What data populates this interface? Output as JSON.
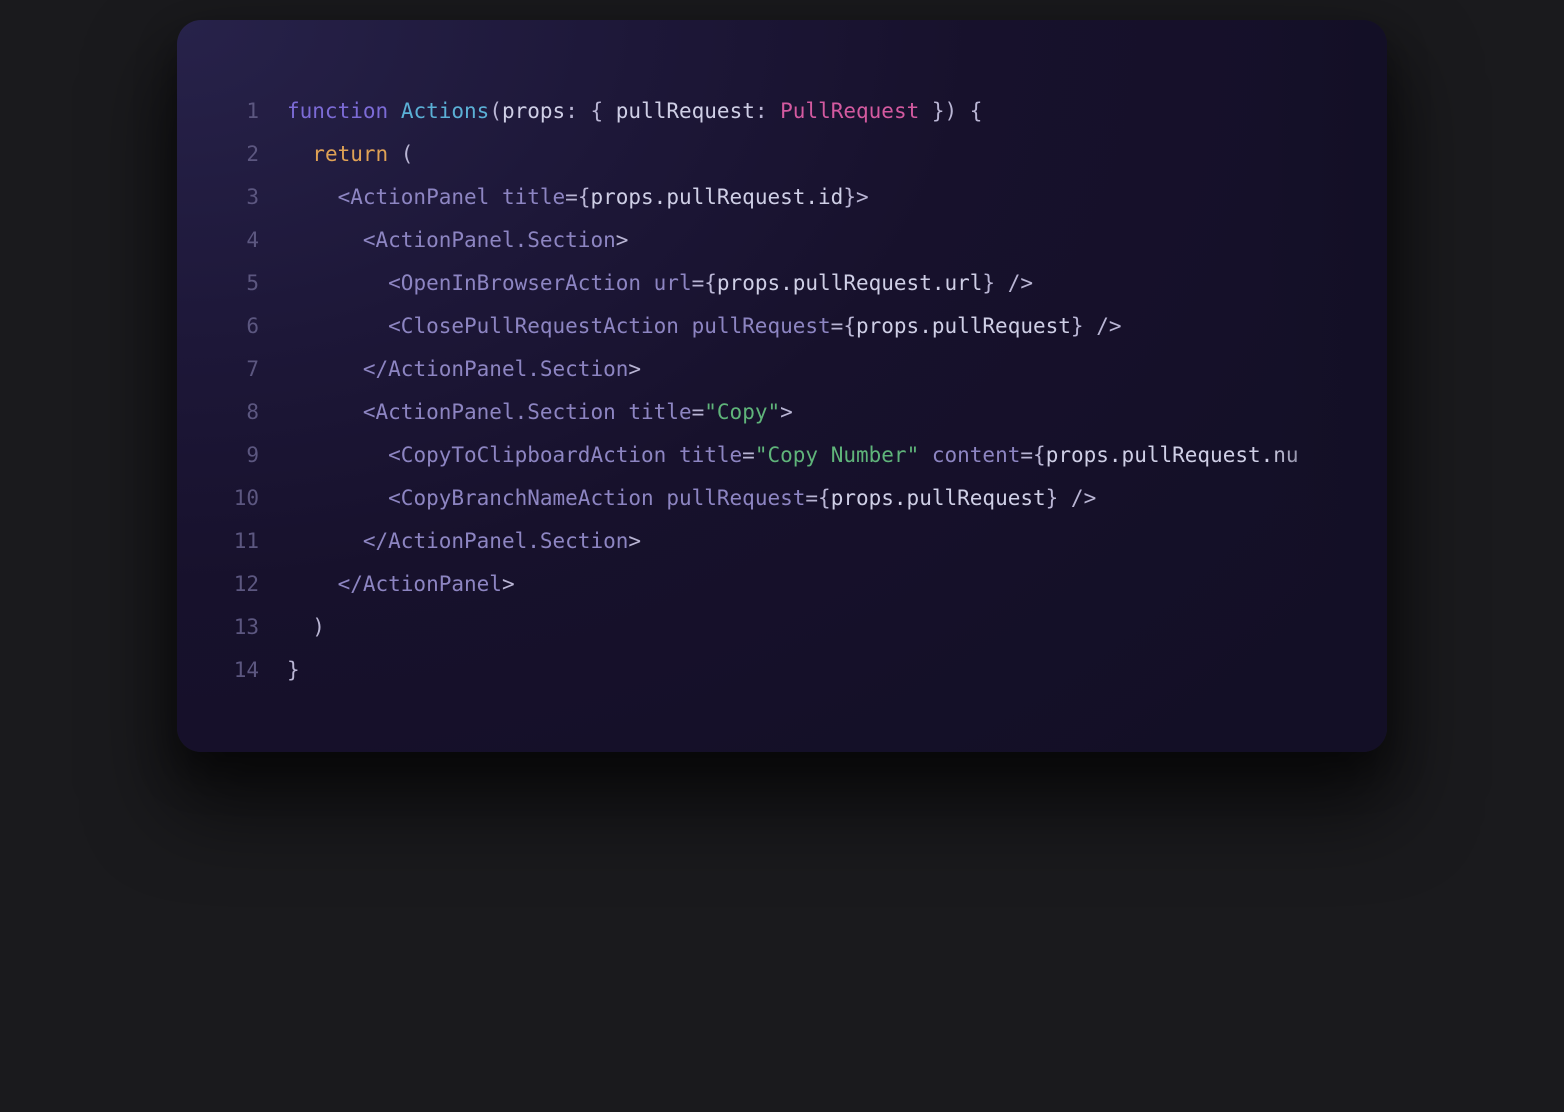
{
  "colors": {
    "keyword_purple": "#7c6bd6",
    "tag_purple": "#8d85c2",
    "function_cyan": "#5bb0d6",
    "return_orange": "#e0a255",
    "type_pink": "#d45aa0",
    "string_green": "#5fb47a",
    "default_white": "#cfcfe6",
    "punct_grey": "#b9b5d4",
    "line_number": "#5c5780"
  },
  "line_numbers": [
    "1",
    "2",
    "3",
    "4",
    "5",
    "6",
    "7",
    "8",
    "9",
    "10",
    "11",
    "12",
    "13",
    "14"
  ],
  "code_lines": [
    [
      {
        "t": "function",
        "c": "keyword_purple"
      },
      {
        "t": " ",
        "c": "default_white"
      },
      {
        "t": "Actions",
        "c": "function_cyan"
      },
      {
        "t": "(",
        "c": "punct_grey"
      },
      {
        "t": "props",
        "c": "default_white"
      },
      {
        "t": ": { ",
        "c": "punct_grey"
      },
      {
        "t": "pullRequest",
        "c": "default_white"
      },
      {
        "t": ": ",
        "c": "punct_grey"
      },
      {
        "t": "PullRequest",
        "c": "type_pink"
      },
      {
        "t": " }) {",
        "c": "punct_grey"
      }
    ],
    [
      {
        "t": "  ",
        "c": "default_white"
      },
      {
        "t": "return",
        "c": "return_orange"
      },
      {
        "t": " (",
        "c": "punct_grey"
      }
    ],
    [
      {
        "t": "    <",
        "c": "tag_purple"
      },
      {
        "t": "ActionPanel",
        "c": "tag_purple"
      },
      {
        "t": " title",
        "c": "tag_purple"
      },
      {
        "t": "=",
        "c": "punct_grey"
      },
      {
        "t": "{",
        "c": "punct_grey"
      },
      {
        "t": "props.pullRequest.id",
        "c": "default_white"
      },
      {
        "t": "}>",
        "c": "punct_grey"
      }
    ],
    [
      {
        "t": "      <",
        "c": "tag_purple"
      },
      {
        "t": "ActionPanel.Section",
        "c": "tag_purple"
      },
      {
        "t": ">",
        "c": "punct_grey"
      }
    ],
    [
      {
        "t": "        <",
        "c": "tag_purple"
      },
      {
        "t": "OpenInBrowserAction",
        "c": "tag_purple"
      },
      {
        "t": " url",
        "c": "tag_purple"
      },
      {
        "t": "=",
        "c": "punct_grey"
      },
      {
        "t": "{",
        "c": "punct_grey"
      },
      {
        "t": "props.pullRequest.url",
        "c": "default_white"
      },
      {
        "t": "} />",
        "c": "punct_grey"
      }
    ],
    [
      {
        "t": "        <",
        "c": "tag_purple"
      },
      {
        "t": "ClosePullRequestAction",
        "c": "tag_purple"
      },
      {
        "t": " pullRequest",
        "c": "tag_purple"
      },
      {
        "t": "=",
        "c": "punct_grey"
      },
      {
        "t": "{",
        "c": "punct_grey"
      },
      {
        "t": "props.pullRequest",
        "c": "default_white"
      },
      {
        "t": "} />",
        "c": "punct_grey"
      }
    ],
    [
      {
        "t": "      </",
        "c": "tag_purple"
      },
      {
        "t": "ActionPanel.Section",
        "c": "tag_purple"
      },
      {
        "t": ">",
        "c": "punct_grey"
      }
    ],
    [
      {
        "t": "      <",
        "c": "tag_purple"
      },
      {
        "t": "ActionPanel.Section",
        "c": "tag_purple"
      },
      {
        "t": " title",
        "c": "tag_purple"
      },
      {
        "t": "=",
        "c": "punct_grey"
      },
      {
        "t": "\"",
        "c": "string_green"
      },
      {
        "t": "Copy",
        "c": "string_green"
      },
      {
        "t": "\"",
        "c": "string_green"
      },
      {
        "t": ">",
        "c": "punct_grey"
      }
    ],
    [
      {
        "t": "        <",
        "c": "tag_purple"
      },
      {
        "t": "CopyToClipboardAction",
        "c": "tag_purple"
      },
      {
        "t": " title",
        "c": "tag_purple"
      },
      {
        "t": "=",
        "c": "punct_grey"
      },
      {
        "t": "\"",
        "c": "string_green"
      },
      {
        "t": "Copy Number",
        "c": "string_green"
      },
      {
        "t": "\"",
        "c": "string_green"
      },
      {
        "t": " content",
        "c": "tag_purple"
      },
      {
        "t": "=",
        "c": "punct_grey"
      },
      {
        "t": "{",
        "c": "punct_grey"
      },
      {
        "t": "props.pullRequest.nu",
        "c": "default_white"
      }
    ],
    [
      {
        "t": "        <",
        "c": "tag_purple"
      },
      {
        "t": "CopyBranchNameAction",
        "c": "tag_purple"
      },
      {
        "t": " pullRequest",
        "c": "tag_purple"
      },
      {
        "t": "=",
        "c": "punct_grey"
      },
      {
        "t": "{",
        "c": "punct_grey"
      },
      {
        "t": "props.pullRequest",
        "c": "default_white"
      },
      {
        "t": "} />",
        "c": "punct_grey"
      }
    ],
    [
      {
        "t": "      </",
        "c": "tag_purple"
      },
      {
        "t": "ActionPanel.Section",
        "c": "tag_purple"
      },
      {
        "t": ">",
        "c": "punct_grey"
      }
    ],
    [
      {
        "t": "    </",
        "c": "tag_purple"
      },
      {
        "t": "ActionPanel",
        "c": "tag_purple"
      },
      {
        "t": ">",
        "c": "punct_grey"
      }
    ],
    [
      {
        "t": "  )",
        "c": "punct_grey"
      }
    ],
    [
      {
        "t": "}",
        "c": "punct_grey"
      }
    ]
  ]
}
